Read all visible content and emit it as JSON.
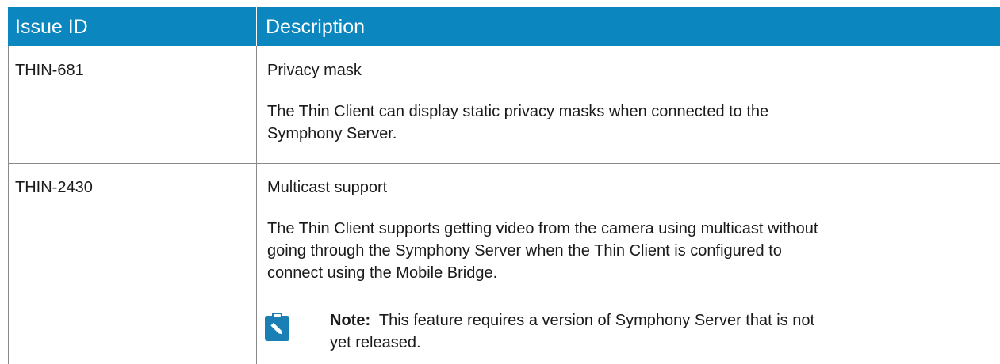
{
  "table": {
    "headers": [
      "Issue ID",
      "Description"
    ],
    "rows": [
      {
        "id": "THIN-681",
        "title": "Privacy mask",
        "description_lines": [
          "The Thin Client can display static privacy masks when connected to the",
          "Symphony Server."
        ]
      },
      {
        "id": "THIN-2430",
        "title": "Multicast support",
        "description_lines": [
          "The Thin Client supports getting video from the camera using multicast without",
          "going through the Symphony Server when the Thin Client is configured to",
          "connect using the Mobile Bridge."
        ],
        "note": {
          "label": "Note:",
          "lines": [
            "This feature requires a version of Symphony Server that is not",
            "yet released."
          ],
          "icon": "pencil-note-icon"
        }
      }
    ]
  },
  "colors": {
    "header_bg": "#0b86be",
    "icon_bg": "#1a7fb5",
    "border": "#8a8a8a"
  }
}
